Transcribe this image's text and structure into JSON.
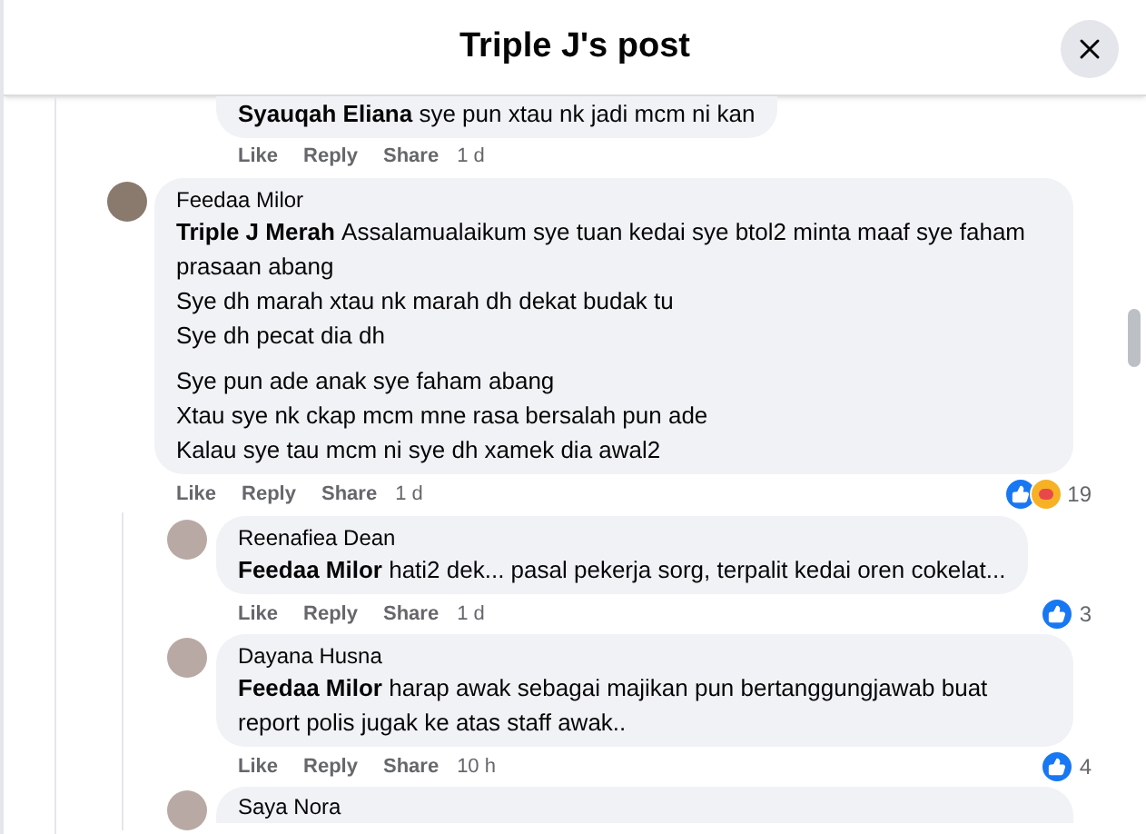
{
  "header": {
    "title": "Triple J's post"
  },
  "earlier_reply": {
    "mention": "Syauqah Eliana",
    "lines": [
      "sye pun xtau nk jadi mcm ni kan"
    ],
    "actions": [
      "Like",
      "Reply",
      "Share"
    ],
    "time": "1 d"
  },
  "comments": [
    {
      "author": "Feedaa Milor",
      "mention": "Triple J Merah",
      "lines": [
        "Assalamualaikum sye tuan kedai sye btol2 minta maaf sye faham prasaan abang",
        "Sye dh marah xtau nk marah dh dekat budak tu",
        "Sye dh pecat dia dh"
      ],
      "lines_after_break": [
        "Sye pun ade anak sye faham abang",
        "Xtau sye nk ckap mcm mne rasa bersalah pun ade",
        "Kalau sye tau mcm ni sye dh xamek dia awal2"
      ],
      "actions": [
        "Like",
        "Reply",
        "Share"
      ],
      "time": "1 d",
      "reactions": [
        {
          "kind": "like"
        },
        {
          "kind": "care"
        }
      ],
      "reaction_count": "19",
      "children": [
        {
          "author": "Reenafiea Dean",
          "mention": "Feedaa Milor",
          "lines": [
            "hati2 dek... pasal pekerja sorg, terpalit kedai oren cokelat..."
          ],
          "actions": [
            "Like",
            "Reply",
            "Share"
          ],
          "time": "1 d",
          "reactions": [
            {
              "kind": "like"
            }
          ],
          "reaction_count": "3"
        },
        {
          "author": "Dayana Husna",
          "mention": "Feedaa Milor",
          "lines": [
            "harap awak sebagai majikan pun bertanggungjawab buat report polis jugak ke atas staff awak.."
          ],
          "actions": [
            "Like",
            "Reply",
            "Share"
          ],
          "time": "10 h",
          "reactions": [
            {
              "kind": "like"
            }
          ],
          "reaction_count": "4"
        },
        {
          "author": "Saya Nora"
        }
      ]
    }
  ]
}
